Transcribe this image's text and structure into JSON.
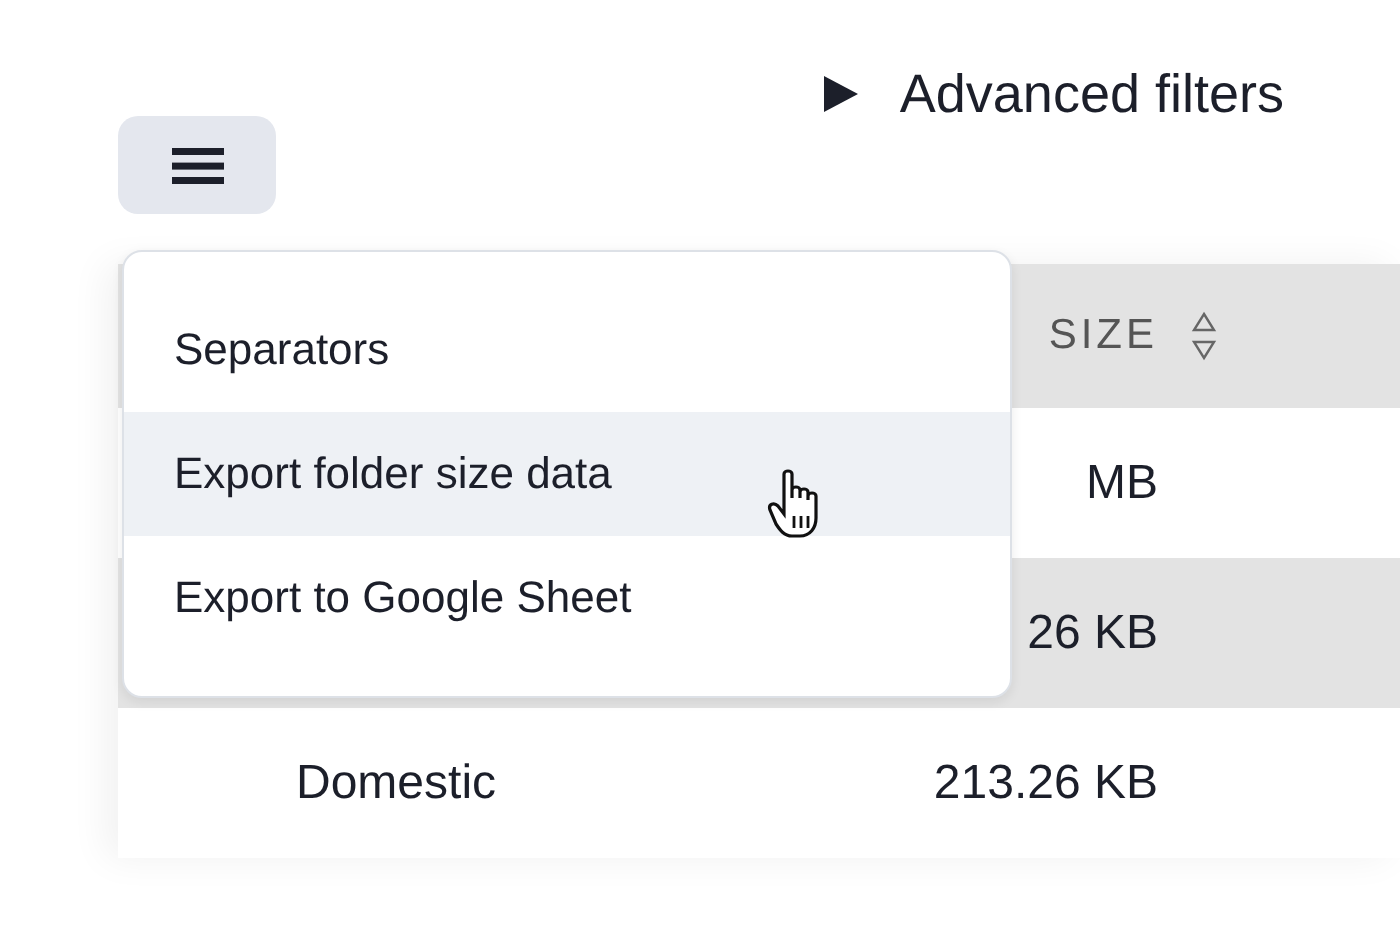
{
  "advanced_filters": {
    "label": "Advanced filters",
    "expanded": false
  },
  "dropdown_menu": {
    "items": [
      {
        "label": "Separators",
        "highlighted": false
      },
      {
        "label": "Export folder size data",
        "highlighted": true
      },
      {
        "label": "Export to Google Sheet",
        "highlighted": false
      }
    ]
  },
  "table": {
    "header": {
      "column_2": "SIZE"
    },
    "rows": [
      {
        "column_2": "MB",
        "shaded": false
      },
      {
        "column_2": "26 KB",
        "shaded": true
      },
      {
        "column_1": "Domestic",
        "column_2": "213.26 KB",
        "shaded": false
      }
    ]
  }
}
